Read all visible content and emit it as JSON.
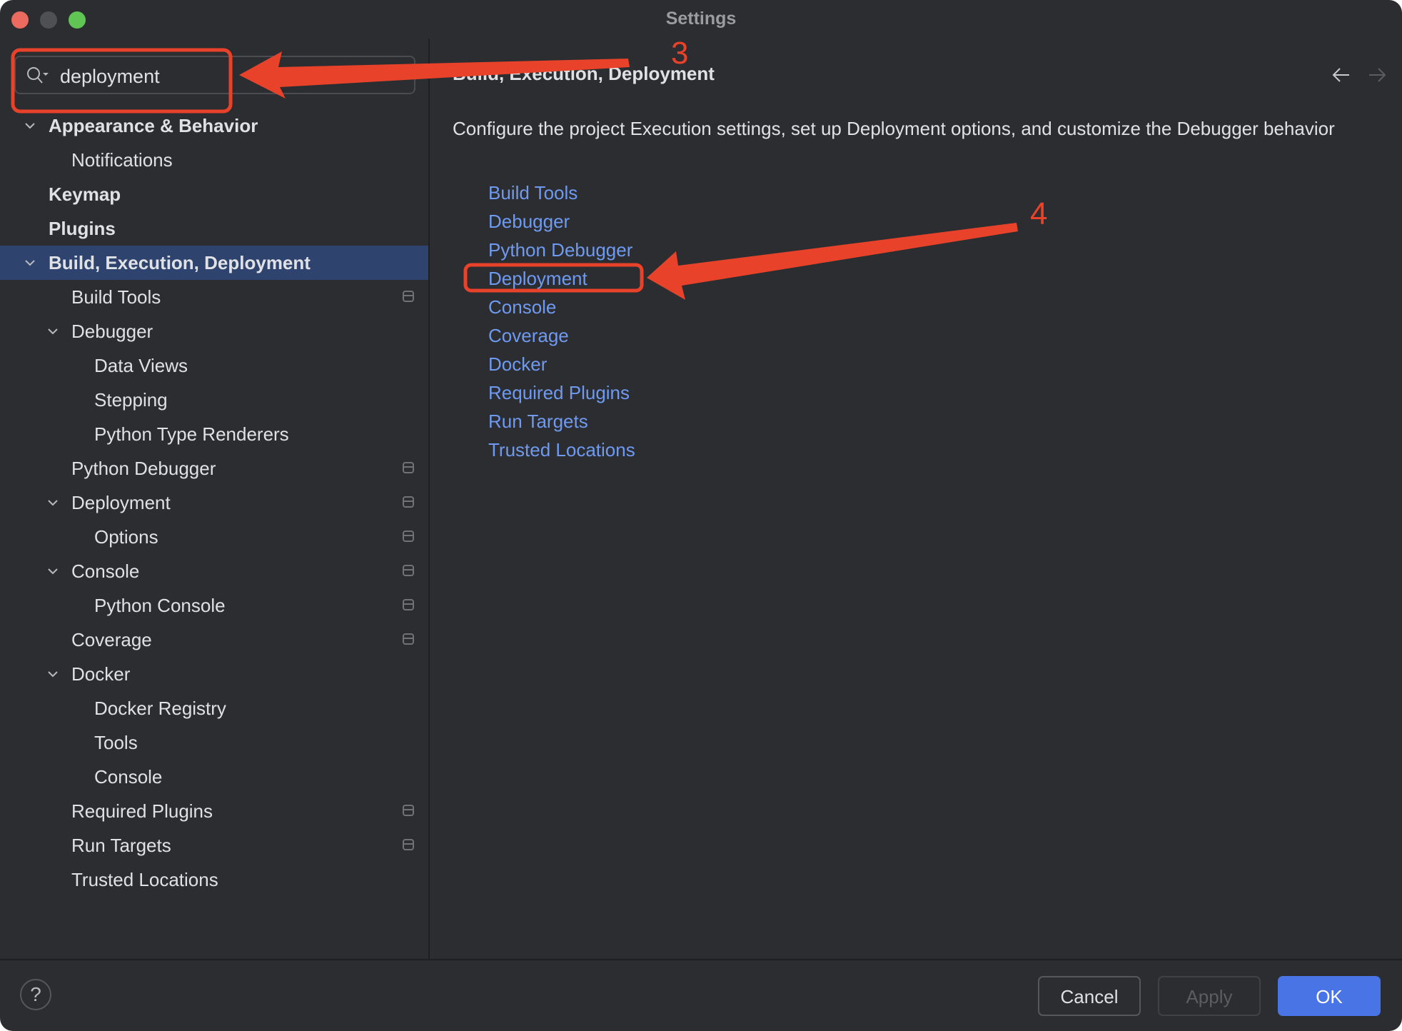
{
  "window": {
    "title": "Settings"
  },
  "search": {
    "value": "deployment",
    "icon": "search-icon",
    "clear_icon": "clear-icon"
  },
  "tree": [
    {
      "label": "Appearance & Behavior",
      "level": 0,
      "bold": true,
      "expanded": true,
      "project_icon": false
    },
    {
      "label": "Notifications",
      "level": 1,
      "bold": false,
      "project_icon": false
    },
    {
      "label": "Keymap",
      "level": 0,
      "bold": true,
      "project_icon": false
    },
    {
      "label": "Plugins",
      "level": 0,
      "bold": true,
      "project_icon": false
    },
    {
      "label": "Build, Execution, Deployment",
      "level": 0,
      "bold": true,
      "expanded": true,
      "selected": true,
      "project_icon": false
    },
    {
      "label": "Build Tools",
      "level": 1,
      "bold": false,
      "project_icon": true
    },
    {
      "label": "Debugger",
      "level": 1,
      "bold": false,
      "expanded": true,
      "project_icon": false
    },
    {
      "label": "Data Views",
      "level": 2,
      "bold": false,
      "project_icon": false
    },
    {
      "label": "Stepping",
      "level": 2,
      "bold": false,
      "project_icon": false
    },
    {
      "label": "Python Type Renderers",
      "level": 2,
      "bold": false,
      "project_icon": false
    },
    {
      "label": "Python Debugger",
      "level": 1,
      "bold": false,
      "project_icon": true
    },
    {
      "label": "Deployment",
      "level": 1,
      "bold": false,
      "expanded": true,
      "project_icon": true
    },
    {
      "label": "Options",
      "level": 2,
      "bold": false,
      "project_icon": true
    },
    {
      "label": "Console",
      "level": 1,
      "bold": false,
      "expanded": true,
      "project_icon": true
    },
    {
      "label": "Python Console",
      "level": 2,
      "bold": false,
      "project_icon": true
    },
    {
      "label": "Coverage",
      "level": 1,
      "bold": false,
      "project_icon": true
    },
    {
      "label": "Docker",
      "level": 1,
      "bold": false,
      "expanded": true,
      "project_icon": false
    },
    {
      "label": "Docker Registry",
      "level": 2,
      "bold": false,
      "project_icon": false
    },
    {
      "label": "Tools",
      "level": 2,
      "bold": false,
      "project_icon": false
    },
    {
      "label": "Console",
      "level": 2,
      "bold": false,
      "project_icon": false
    },
    {
      "label": "Required Plugins",
      "level": 1,
      "bold": false,
      "project_icon": true
    },
    {
      "label": "Run Targets",
      "level": 1,
      "bold": false,
      "project_icon": true
    },
    {
      "label": "Trusted Locations",
      "level": 1,
      "bold": false,
      "project_icon": false
    }
  ],
  "content": {
    "heading": "Build, Execution, Deployment",
    "description": "Configure the project Execution settings, set up Deployment options, and customize the Debugger behavior",
    "links": [
      "Build Tools",
      "Debugger",
      "Python Debugger",
      "Deployment",
      "Console",
      "Coverage",
      "Docker",
      "Required Plugins",
      "Run Targets",
      "Trusted Locations"
    ],
    "nav_back_icon": "arrow-left-icon",
    "nav_forward_icon": "arrow-right-icon"
  },
  "footer": {
    "help_label": "?",
    "cancel_label": "Cancel",
    "apply_label": "Apply",
    "ok_label": "OK"
  },
  "annotations": {
    "step_3": "3",
    "step_4": "4",
    "color": "#e8432a"
  },
  "colors": {
    "background": "#2b2d30",
    "selection": "#2e436e",
    "link": "#6f9af0",
    "primary_button": "#4874e6",
    "text": "#dfe1e5"
  }
}
